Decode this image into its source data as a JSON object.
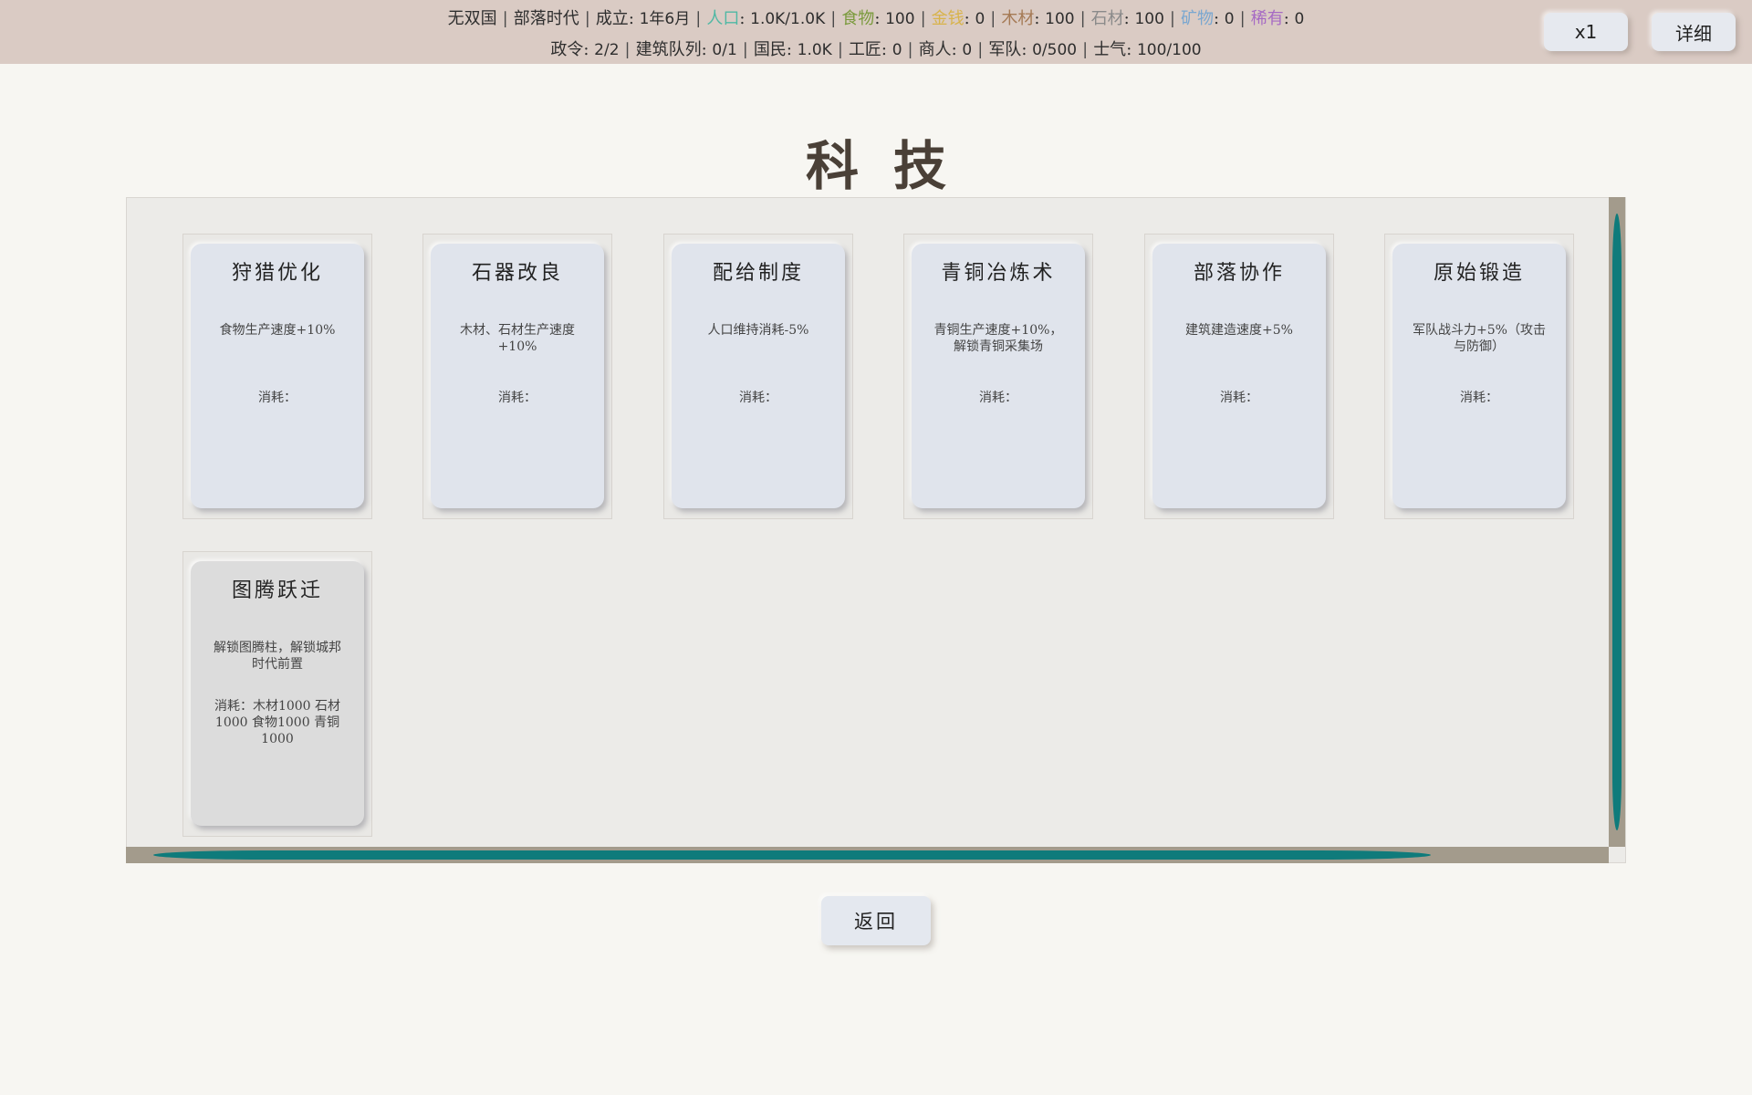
{
  "status": {
    "line1": [
      {
        "text": "无双国",
        "color": "#2e2e2e"
      },
      {
        "text": "部落时代",
        "color": "#2e2e2e"
      },
      {
        "label": "成立",
        "value": "1年6月",
        "color": "#2e2e2e"
      },
      {
        "label": "人口",
        "value": "1.0K/1.0K",
        "color": "#4fb8a4"
      },
      {
        "label": "食物",
        "value": "100",
        "color": "#7a9a3c"
      },
      {
        "label": "金钱",
        "value": "0",
        "color": "#d8b34a"
      },
      {
        "label": "木材",
        "value": "100",
        "color": "#a57a55"
      },
      {
        "label": "石材",
        "value": "100",
        "color": "#8a8a8a"
      },
      {
        "label": "矿物",
        "value": "0",
        "color": "#7aa7d0"
      },
      {
        "label": "稀有",
        "value": "0",
        "color": "#a66ac4"
      }
    ],
    "line2": [
      {
        "label": "政令",
        "value": "2/2"
      },
      {
        "label": "建筑队列",
        "value": "0/1"
      },
      {
        "label": "国民",
        "value": "1.0K"
      },
      {
        "label": "工匠",
        "value": "0"
      },
      {
        "label": "商人",
        "value": "0"
      },
      {
        "label": "军队",
        "value": "0/500"
      },
      {
        "label": "士气",
        "value": "100/100"
      }
    ]
  },
  "toolbar": {
    "speed_label": "x1",
    "detail_label": "详细"
  },
  "page_title": "科技",
  "techs": [
    {
      "name": "狩猎优化",
      "desc": "食物生产速度+10%",
      "cost": "消耗：",
      "locked": false
    },
    {
      "name": "石器改良",
      "desc": "木材、石材生产速度\n+10%",
      "cost": "消耗：",
      "locked": false
    },
    {
      "name": "配给制度",
      "desc": "人口维持消耗-5%",
      "cost": "消耗：",
      "locked": false
    },
    {
      "name": "青铜冶炼术",
      "desc": "青铜生产速度+10%，\n解锁青铜采集场",
      "cost": "消耗：",
      "locked": false
    },
    {
      "name": "部落协作",
      "desc": "建筑建造速度+5%",
      "cost": "消耗：",
      "locked": false
    },
    {
      "name": "原始锻造",
      "desc": "军队战斗力+5%（攻击\n与防御）",
      "cost": "消耗：",
      "locked": false
    },
    {
      "name": "图腾跃迁",
      "desc": "解锁图腾柱，解锁城邦\n时代前置",
      "cost": "消耗：木材1000 石材\n1000 食物1000 青铜\n1000",
      "locked": true
    }
  ],
  "back_label": "返回"
}
